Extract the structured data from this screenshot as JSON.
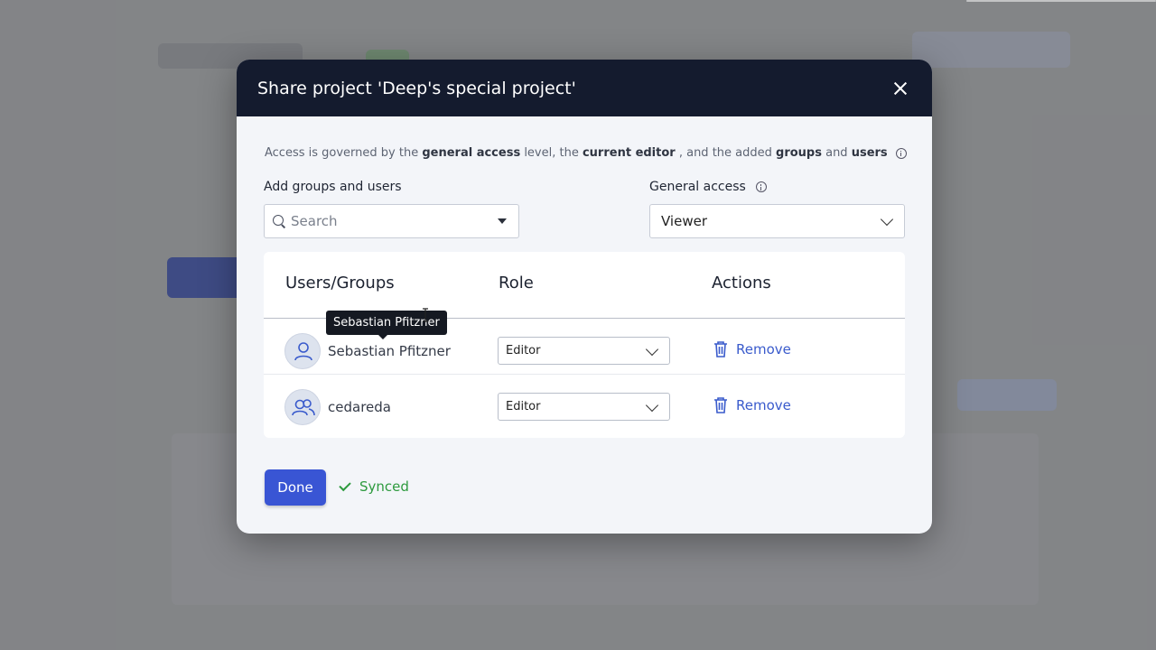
{
  "modal": {
    "title": "Share project 'Deep's special project'",
    "info": {
      "p1": "Access is governed by the ",
      "b1": "general access",
      "p2": " level, the ",
      "b2": "current editor",
      "p3": " , and the added ",
      "b3": "groups",
      "p4": " and ",
      "b4": "users"
    },
    "add_label": "Add groups and users",
    "search_placeholder": "Search",
    "general_access_label": "General access",
    "general_access_value": "Viewer",
    "table": {
      "headers": [
        "Users/Groups",
        "Role",
        "Actions"
      ],
      "rows": [
        {
          "name": "Sebastian Pfitzner",
          "type": "user-icon",
          "role": "Editor",
          "action": "Remove"
        },
        {
          "name": "cedareda",
          "type": "group-icon",
          "role": "Editor",
          "action": "Remove"
        }
      ]
    },
    "tooltip": "Sebastian Pfitzner",
    "done_label": "Done",
    "status": "Synced"
  },
  "colors": {
    "header": "#141b2e",
    "primary": "#3955d4",
    "link": "#3a5bcc",
    "success": "#2d9a3e"
  }
}
